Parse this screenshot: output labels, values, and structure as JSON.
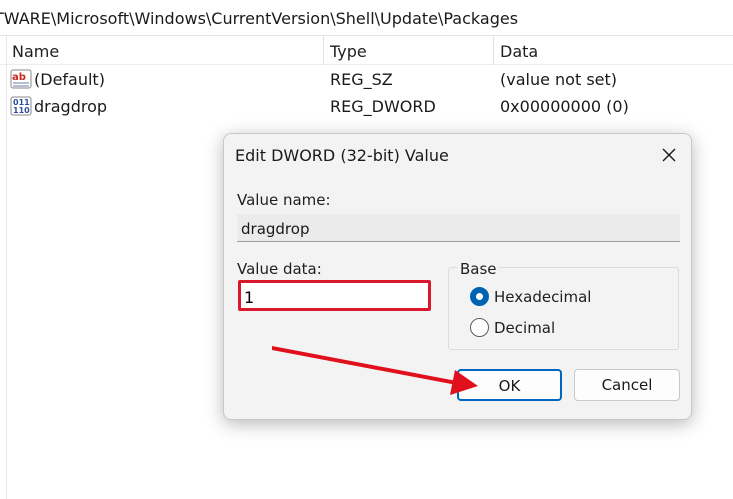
{
  "address_bar": {
    "path": "TWARE\\Microsoft\\Windows\\CurrentVersion\\Shell\\Update\\Packages"
  },
  "list": {
    "columns": [
      "Name",
      "Type",
      "Data"
    ],
    "rows": [
      {
        "icon": "string-value-icon",
        "name": "(Default)",
        "type": "REG_SZ",
        "data": "(value not set)"
      },
      {
        "icon": "binary-value-icon",
        "name": "dragdrop",
        "type": "REG_DWORD",
        "data": "0x00000000 (0)"
      }
    ]
  },
  "dialog": {
    "title": "Edit DWORD (32-bit) Value",
    "value_name_label": "Value name:",
    "value_name": "dragdrop",
    "value_data_label": "Value data:",
    "value_data": "1",
    "base_label": "Base",
    "base_options": [
      {
        "label": "Hexadecimal",
        "selected": true
      },
      {
        "label": "Decimal",
        "selected": false
      }
    ],
    "ok_label": "OK",
    "cancel_label": "Cancel"
  },
  "annotation": {
    "highlight_color": "#d9182d",
    "arrow_color": "#e0101c"
  }
}
